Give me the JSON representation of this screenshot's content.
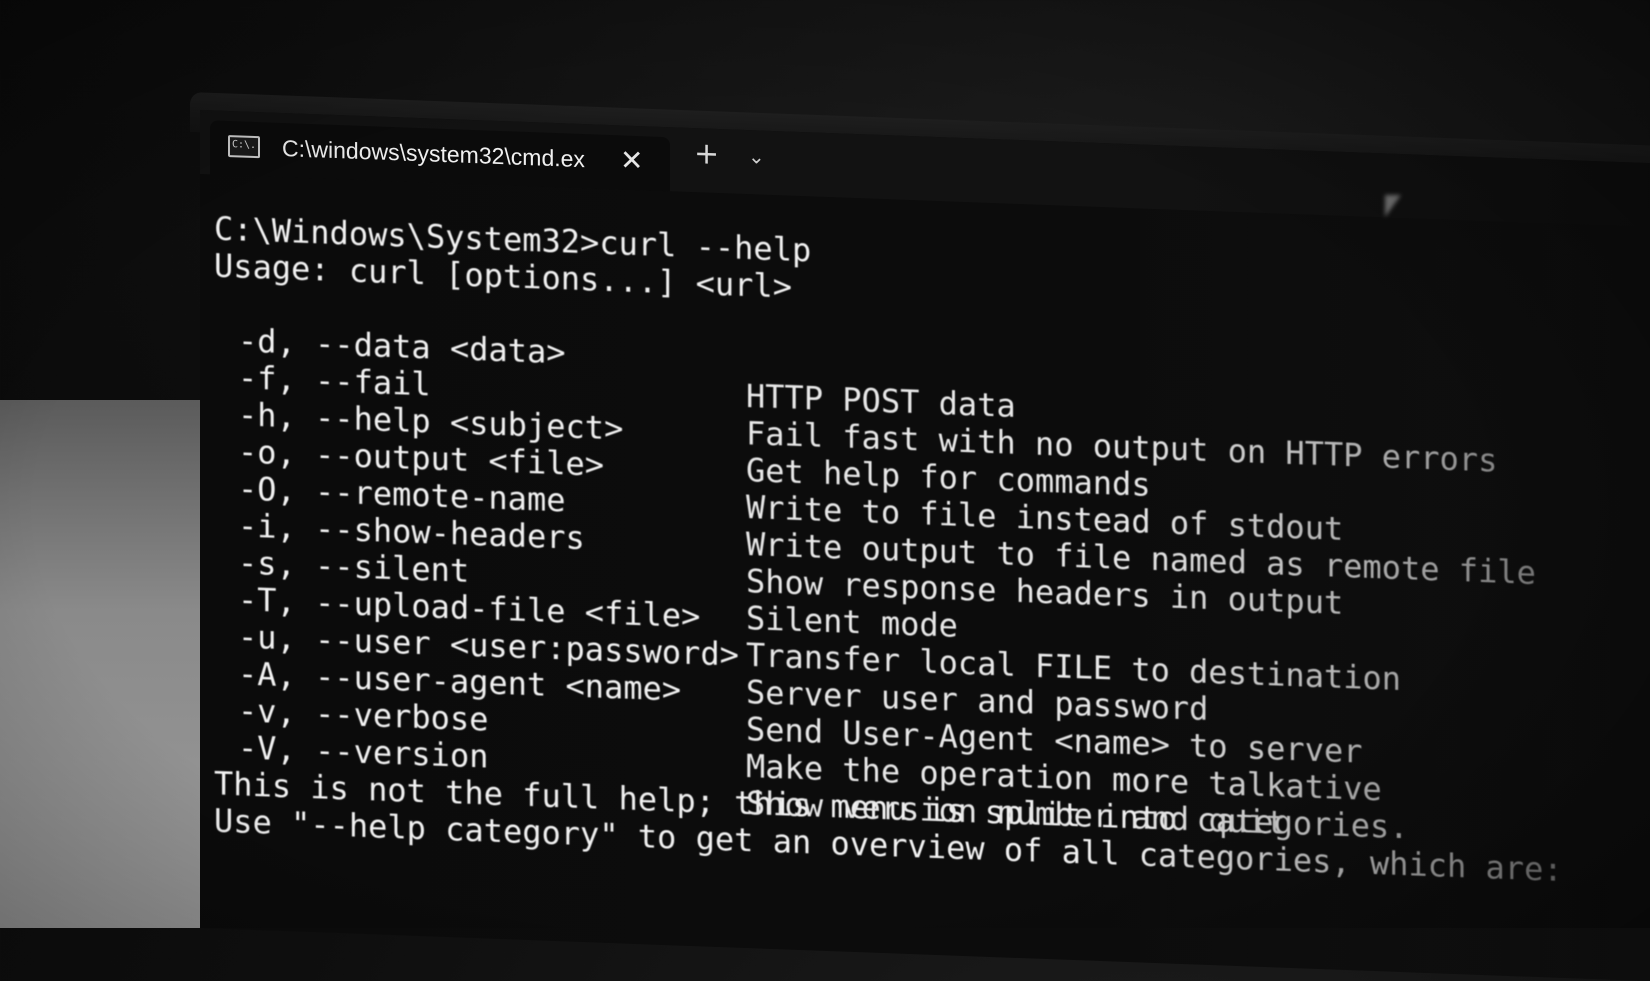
{
  "tab": {
    "icon_text": "C:\\.",
    "title": "C:\\windows\\system32\\cmd.ex",
    "close_glyph": "✕",
    "new_tab_glyph": "+",
    "menu_glyph": "⌄"
  },
  "terminal": {
    "prompt_line": "C:\\Windows\\System32>curl --help",
    "usage_line": "Usage: curl [options...] <url>",
    "options": [
      {
        "flag": "-d, --data <data>",
        "desc": "HTTP POST data"
      },
      {
        "flag": "-f, --fail",
        "desc": "Fail fast with no output on HTTP errors"
      },
      {
        "flag": "-h, --help <subject>",
        "desc": "Get help for commands"
      },
      {
        "flag": "-o, --output <file>",
        "desc": "Write to file instead of stdout"
      },
      {
        "flag": "-O, --remote-name",
        "desc": "Write output to file named as remote file"
      },
      {
        "flag": "-i, --show-headers",
        "desc": "Show response headers in output"
      },
      {
        "flag": "-s, --silent",
        "desc": "Silent mode"
      },
      {
        "flag": "-T, --upload-file <file>",
        "desc": "Transfer local FILE to destination"
      },
      {
        "flag": "-u, --user <user:password>",
        "desc": "Server user and password"
      },
      {
        "flag": "-A, --user-agent <name>",
        "desc": "Send User-Agent <name> to server"
      },
      {
        "flag": "-v, --verbose",
        "desc": "Make the operation more talkative"
      },
      {
        "flag": "-V, --version",
        "desc": "Show version number and quit"
      }
    ],
    "footer_line_1": "This is not the full help; this menu is split into categories.",
    "footer_line_2": "Use \"--help category\" to get an overview of all categories, which are:"
  }
}
